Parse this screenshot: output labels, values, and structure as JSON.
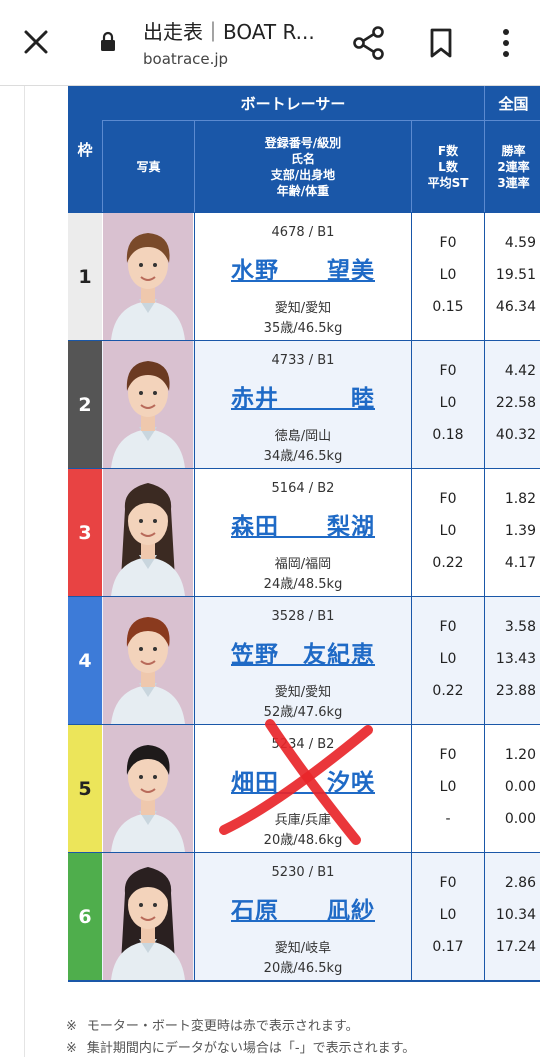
{
  "browser": {
    "title": "出走表｜BOAT R...",
    "url": "boatrace.jp"
  },
  "table": {
    "header": {
      "waku": "枠",
      "boatracer": "ボートレーサー",
      "zenkoku": "全国",
      "photo": "写真",
      "info_lines": [
        "登録番号/級別",
        "氏名",
        "支部/出身地",
        "年齢/体重"
      ],
      "fl_lines": [
        "F数",
        "L数",
        "平均ST"
      ],
      "rate_lines": [
        "勝率",
        "2連率",
        "3連率"
      ]
    },
    "rows": [
      {
        "waku": "1",
        "waku_color": "#ececec",
        "waku_text": "#222222",
        "reg": "4678 / B1",
        "name": "水野　　望美",
        "branch": "愛知/愛知",
        "age_weight": "35歳/46.5kg",
        "f": "F0",
        "l": "L0",
        "st": "0.15",
        "win": "4.59",
        "r2": "19.51",
        "r3": "46.34"
      },
      {
        "waku": "2",
        "waku_color": "#555555",
        "waku_text": "#ffffff",
        "reg": "4733 / B1",
        "name": "赤井　　　睦",
        "branch": "徳島/岡山",
        "age_weight": "34歳/46.5kg",
        "f": "F0",
        "l": "L0",
        "st": "0.18",
        "win": "4.42",
        "r2": "22.58",
        "r3": "40.32"
      },
      {
        "waku": "3",
        "waku_color": "#e84343",
        "waku_text": "#ffffff",
        "reg": "5164 / B2",
        "name": "森田　　梨湖",
        "branch": "福岡/福岡",
        "age_weight": "24歳/48.5kg",
        "f": "F0",
        "l": "L0",
        "st": "0.22",
        "win": "1.82",
        "r2": "1.39",
        "r3": "4.17"
      },
      {
        "waku": "4",
        "waku_color": "#3d7bd8",
        "waku_text": "#ffffff",
        "reg": "3528 / B1",
        "name": "笠野　友紀恵",
        "branch": "愛知/愛知",
        "age_weight": "52歳/47.6kg",
        "f": "F0",
        "l": "L0",
        "st": "0.22",
        "win": "3.58",
        "r2": "13.43",
        "r3": "23.88"
      },
      {
        "waku": "5",
        "waku_color": "#ece55a",
        "waku_text": "#222222",
        "reg": "5234 / B2",
        "name": "畑田　　汐咲",
        "branch": "兵庫/兵庫",
        "age_weight": "20歳/48.6kg",
        "f": "F0",
        "l": "L0",
        "st": "-",
        "win": "1.20",
        "r2": "0.00",
        "r3": "0.00"
      },
      {
        "waku": "6",
        "waku_color": "#4fae4c",
        "waku_text": "#ffffff",
        "reg": "5230 / B1",
        "name": "石原　　凪紗",
        "branch": "愛知/岐阜",
        "age_weight": "20歳/46.5kg",
        "f": "F0",
        "l": "L0",
        "st": "0.17",
        "win": "2.86",
        "r2": "10.34",
        "r3": "17.24"
      }
    ]
  },
  "notes": {
    "mark": "※",
    "line1": "モーター・ボート変更時は赤で表示されます。",
    "line2": "集計期間内にデータがない場合は「-」で表示されます。"
  },
  "icons": [
    "close-icon",
    "lock-icon",
    "share-icon",
    "bookmark-icon",
    "more-vert-icon"
  ],
  "colors": {
    "header_blue": "#1a57a8",
    "link_blue": "#1f6ac6",
    "cross_red": "#e8262a"
  }
}
